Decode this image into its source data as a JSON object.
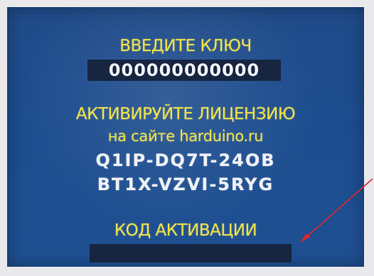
{
  "screen": {
    "enter_key_title": "ВВЕДИТЕ КЛЮЧ",
    "key_value": "000000000000",
    "activate_title": "АКТИВИРУЙТЕ ЛИЦЕНЗИЮ",
    "activate_subtitle": "на сайте harduino.ru",
    "license_code_line1": "Q1IP-DQ7T-24OB",
    "license_code_line2": "BT1X-VZVI-5RYG",
    "activation_code_title": "КОД АКТИВАЦИИ",
    "activation_code_value": ""
  },
  "colors": {
    "background": "#1a4c90",
    "label_yellow": "#f2e44a",
    "value_white": "#f4f6fb",
    "field_dark": "#14233f",
    "arrow_red": "#e0282a"
  }
}
